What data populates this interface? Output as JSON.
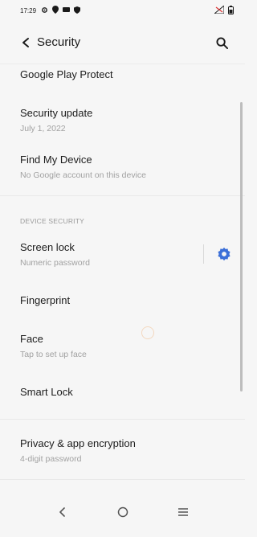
{
  "status_bar": {
    "time": "17:29",
    "icons": [
      "gear-icon",
      "location-icon",
      "message-icon",
      "shield-icon"
    ],
    "right_icons": [
      "no-signal-icon",
      "battery-icon"
    ]
  },
  "header": {
    "title": "Security"
  },
  "items": [
    {
      "title": "Google Play Protect",
      "subtitle": ""
    },
    {
      "title": "Security update",
      "subtitle": "July 1, 2022"
    },
    {
      "title": "Find My Device",
      "subtitle": "No Google account on this device"
    }
  ],
  "section": {
    "label": "DEVICE SECURITY"
  },
  "device_items": [
    {
      "title": "Screen lock",
      "subtitle": "Numeric password"
    },
    {
      "title": "Fingerprint",
      "subtitle": ""
    },
    {
      "title": "Face",
      "subtitle": "Tap to set up face"
    },
    {
      "title": "Smart Lock",
      "subtitle": ""
    }
  ],
  "privacy": {
    "title": "Privacy & app encryption",
    "subtitle": "4-digit password"
  },
  "colors": {
    "accent": "#3b6fd8",
    "background": "#f6f6f6"
  }
}
